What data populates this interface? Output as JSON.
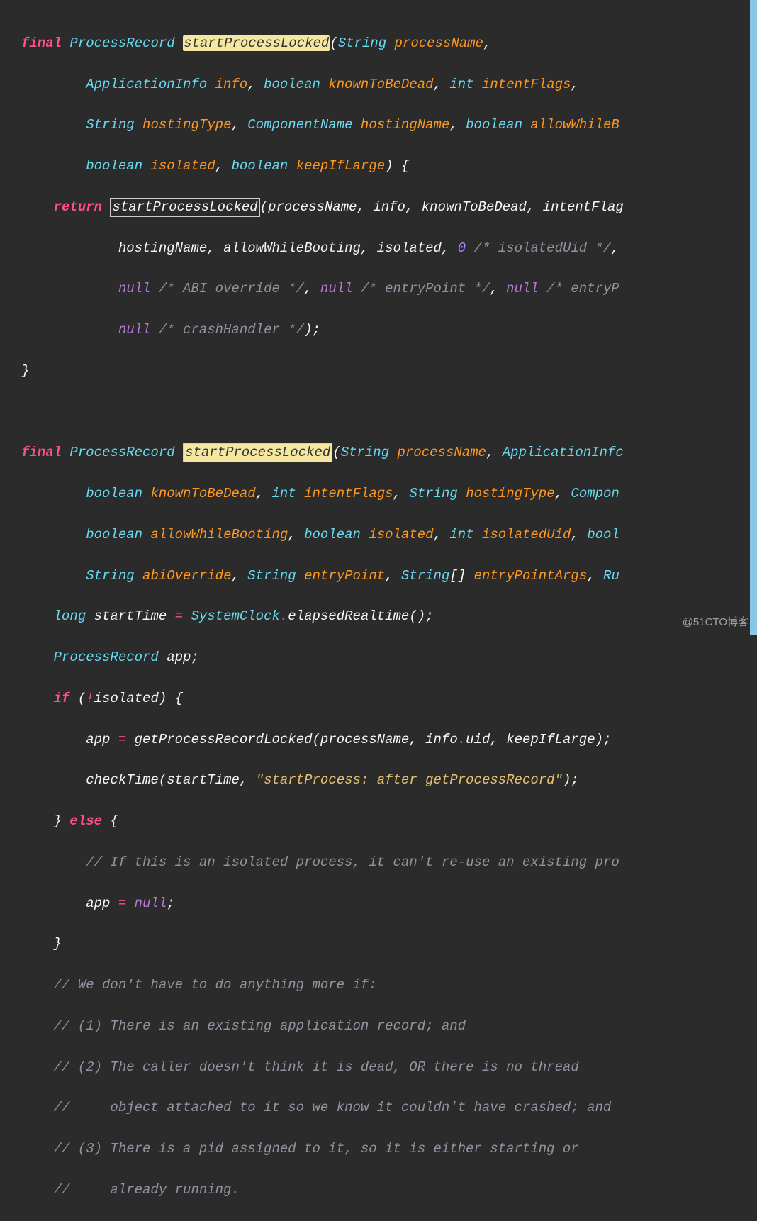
{
  "watermark": "@51CTO博客",
  "tok": {
    "final": "final",
    "return": "return",
    "if": "if",
    "else": "else",
    "null": "null",
    "long": "long",
    "int": "int",
    "boolean": "boolean",
    "zero": "0",
    "excl": "!"
  },
  "types": {
    "ProcessRecord": "ProcessRecord",
    "String": "String",
    "ApplicationInfo": "ApplicationInfo",
    "ComponentName": "ComponentName",
    "SystemClock": "SystemClock",
    "StringArr": "String",
    "Compon": "Compon",
    "ApplicationInfc": "ApplicationInfc",
    "bool_cut": "bool",
    "Ru": "Ru"
  },
  "methods": {
    "startProcessLocked": "startProcessLocked",
    "elapsedRealtime": "elapsedRealtime",
    "getProcessRecordLocked": "getProcessRecordLocked",
    "checkTime": "checkTime"
  },
  "params": {
    "processName": "processName",
    "info": "info",
    "knownToBeDead": "knownToBeDead",
    "intentFlags": "intentFlags",
    "hostingType": "hostingType",
    "hostingName": "hostingName",
    "allowWhileBooting": "allowWhileBooting",
    "allowWhileB_cut": "allowWhileB",
    "isolated": "isolated",
    "keepIfLarge": "keepIfLarge",
    "isolatedUid": "isolatedUid",
    "abiOverride": "abiOverride",
    "entryPoint": "entryPoint",
    "entryPointArgs": "entryPointArgs"
  },
  "idents": {
    "processName": "processName",
    "info": "info",
    "knownToBeDead": "knownToBeDead",
    "intentFlag_cut": "intentFlag",
    "hostingName": "hostingName",
    "allowWhileBooting": "allowWhileBooting",
    "isolated": "isolated",
    "startTime": "startTime",
    "app": "app",
    "uid": "uid",
    "keepIfLarge": "keepIfLarge"
  },
  "comments": {
    "isolatedUid": "/* isolatedUid */",
    "abiOverride": "/* ABI override */",
    "entryPoint": "/* entryPoint */",
    "entryP_cut": "/* entryP",
    "crashHandler": "/* crashHandler */",
    "ifIsolated": "// If this is an isolated process, it can't re-use an existing pro",
    "weDont": "// We don't have to do anything more if:",
    "c1": "// (1) There is an existing application record; and",
    "c2a": "// (2) The caller doesn't think it is dead, OR there is no thread",
    "c2b": "//     object attached to it so we know it couldn't have crashed; and",
    "c3a": "// (3) There is a pid assigned to it, so it is either starting or",
    "c3b": "//     already running."
  },
  "strings": {
    "afterGet": "\"startProcess: after getProcessRecord\""
  }
}
